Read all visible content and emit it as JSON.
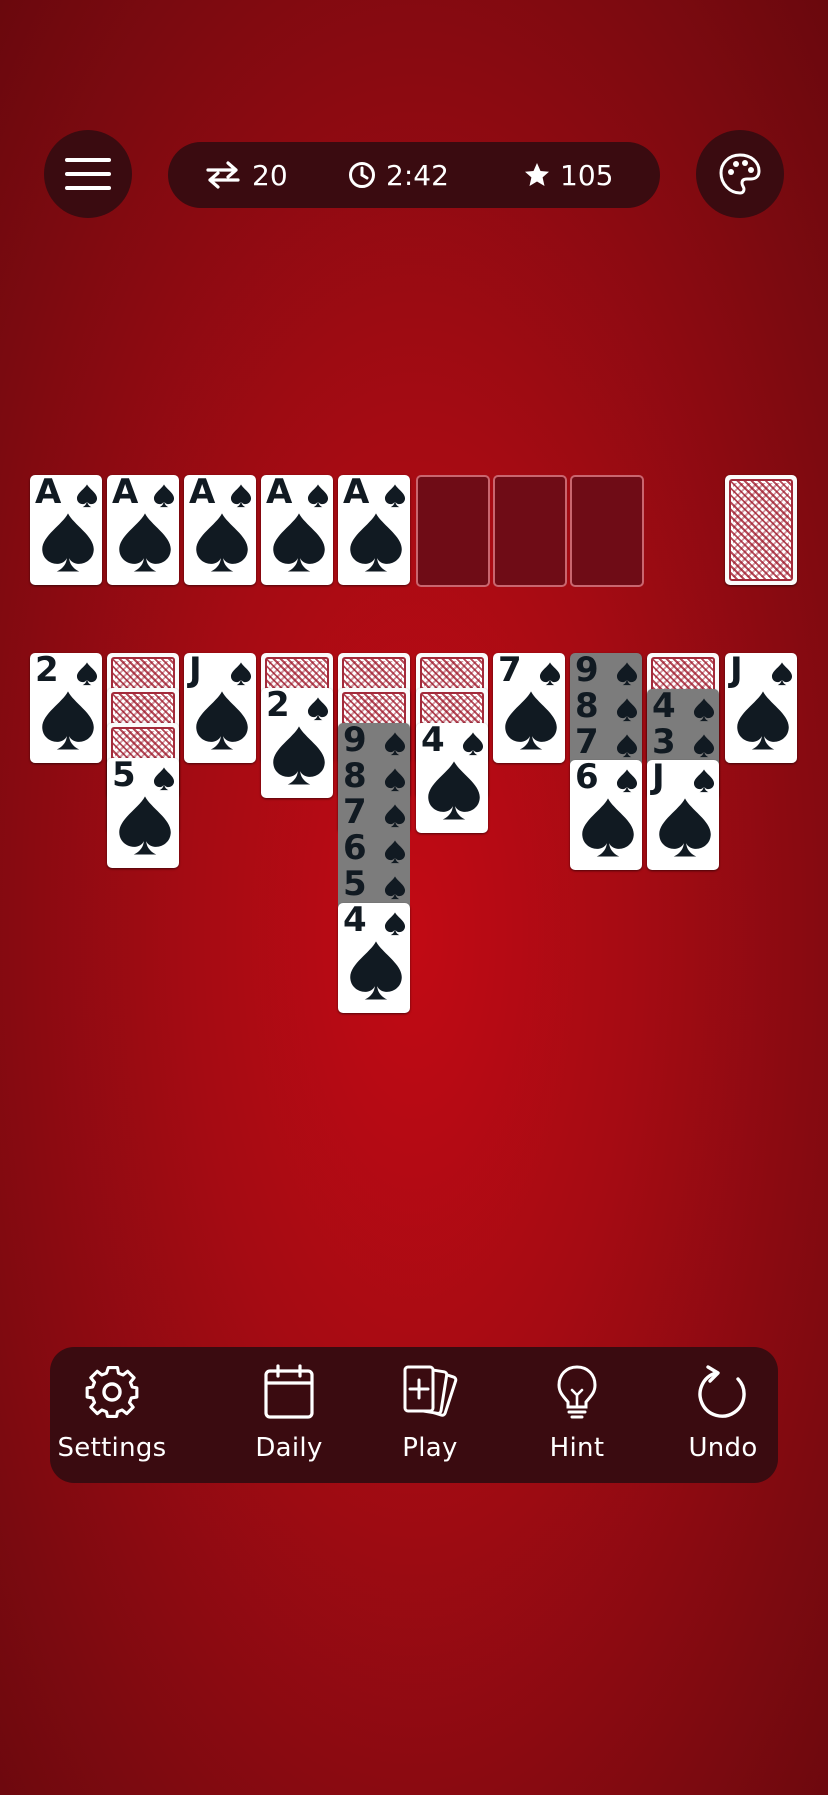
{
  "stats": {
    "moves": "20",
    "time": "2:42",
    "score": "105"
  },
  "foundations": [
    {
      "rank": "A",
      "suit": "spade"
    },
    {
      "rank": "A",
      "suit": "spade"
    },
    {
      "rank": "A",
      "suit": "spade"
    },
    {
      "rank": "A",
      "suit": "spade"
    },
    {
      "rank": "A",
      "suit": "spade"
    }
  ],
  "empty_foundations": 3,
  "stock": {
    "face_down": true
  },
  "tableau": [
    [
      "2♠"
    ],
    [
      "back",
      "back",
      "back",
      "5♠"
    ],
    [
      "J♠"
    ],
    [
      "back",
      "2♠"
    ],
    [
      "back",
      "back",
      "9♠",
      "8♠",
      "7♠",
      "6♠",
      "5♠",
      "4♠"
    ],
    [
      "back",
      "back",
      "4♠"
    ],
    [
      "7♠"
    ],
    [
      "9♠",
      "8♠",
      "7♠",
      "6♠"
    ],
    [
      "back",
      "4♠",
      "3♠",
      "J♠"
    ],
    [
      "J♠"
    ]
  ],
  "cards": {
    "f0": "A",
    "f1": "A",
    "f2": "A",
    "f3": "A",
    "f4": "A",
    "c0": "2",
    "c1": "5",
    "c2": "J",
    "c3": "2",
    "c4a": "9",
    "c4b": "8",
    "c4c": "7",
    "c4d": "6",
    "c4e": "5",
    "c4f": "4",
    "c5": "4",
    "c6": "7",
    "c7a": "9",
    "c7b": "8",
    "c7c": "7",
    "c7d": "6",
    "c8a": "4",
    "c8b": "3",
    "c8c": "J",
    "c9": "J"
  },
  "toolbar": {
    "settings": "Settings",
    "daily": "Daily",
    "play": "Play",
    "hint": "Hint",
    "undo": "Undo"
  },
  "colors": {
    "felt": "#b00a12",
    "panel": "#3a0b10",
    "highlight": "#7c7c7c",
    "ink": "#111a22"
  }
}
